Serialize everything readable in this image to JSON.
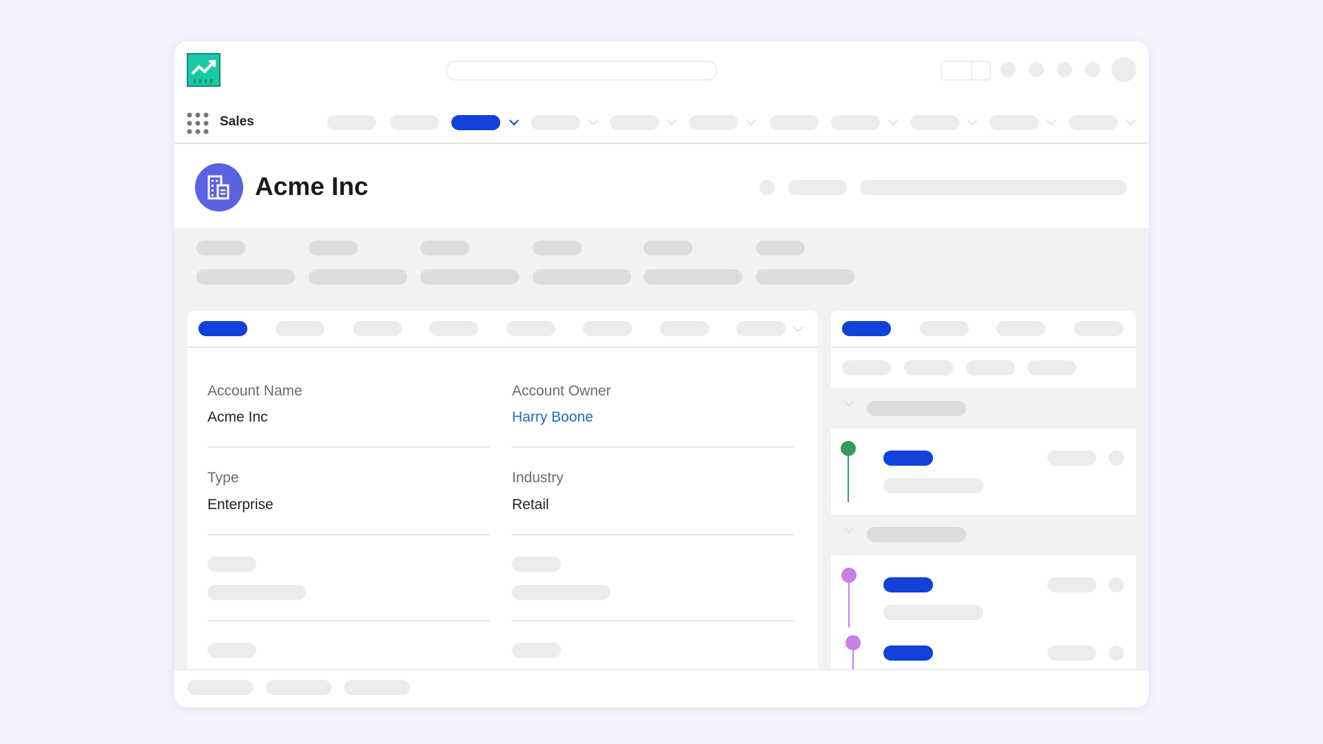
{
  "app": {
    "name": "Sales"
  },
  "record": {
    "title": "Acme Inc",
    "icon": "building-icon"
  },
  "nav": {
    "active_index": 2
  },
  "details": {
    "fields": [
      {
        "label": "Account Name",
        "value": "Acme Inc"
      },
      {
        "label": "Account Owner",
        "value": "Harry Boone",
        "is_link": true
      },
      {
        "label": "Type",
        "value": "Enterprise"
      },
      {
        "label": "Industry",
        "value": "Retail"
      }
    ]
  },
  "activity": {
    "items": [
      {
        "status_color": "#3a9a5c"
      },
      {
        "status_color": "#c97ee8"
      },
      {
        "status_color": "#c97ee8"
      }
    ]
  },
  "colors": {
    "accent": "#1141d8",
    "logo": "#19c9a6",
    "avatar": "#5b63e0",
    "link": "#1f6fb5"
  }
}
